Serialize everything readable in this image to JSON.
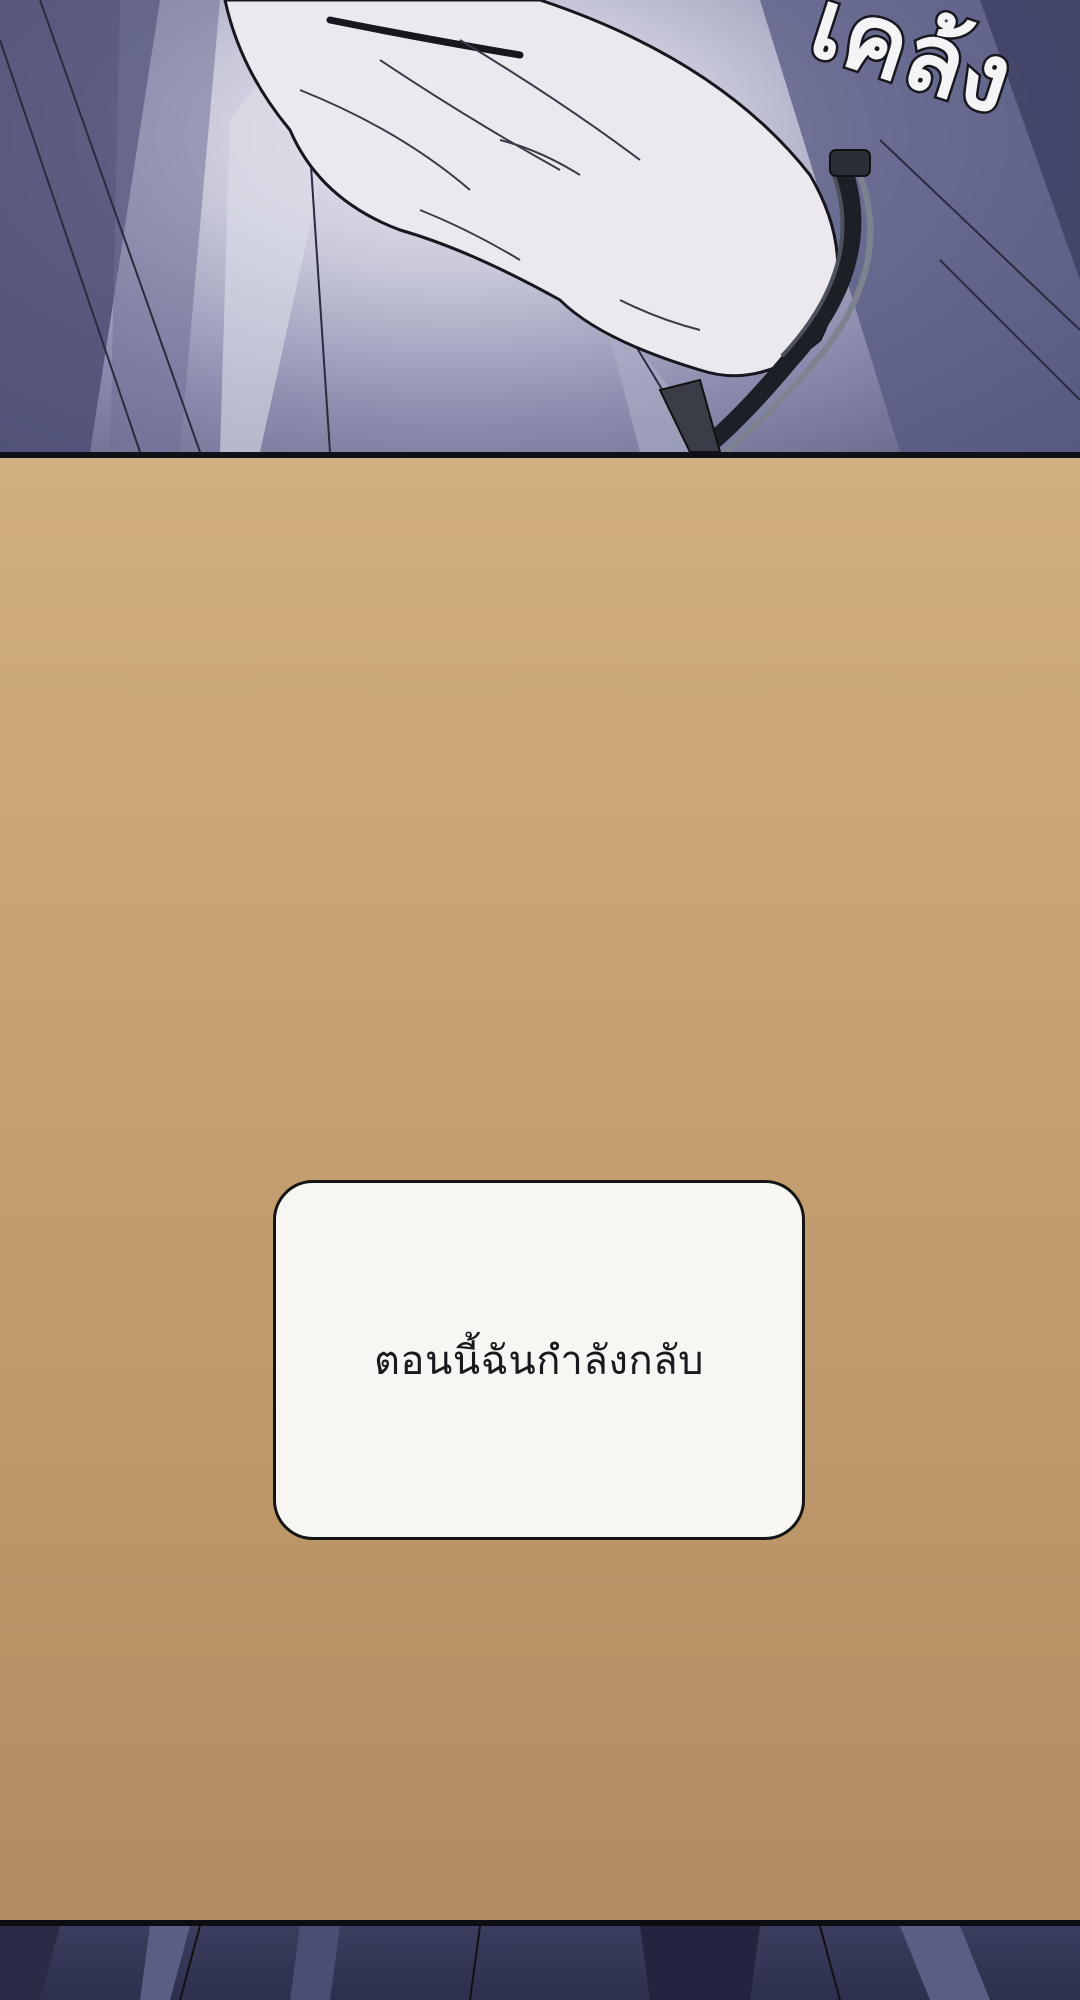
{
  "panels": {
    "top": {
      "sfx_text": "เคล้ง"
    },
    "middle": {
      "narration_box": {
        "text": "ตอนนี้ฉันกำลังกลับ"
      }
    }
  }
}
